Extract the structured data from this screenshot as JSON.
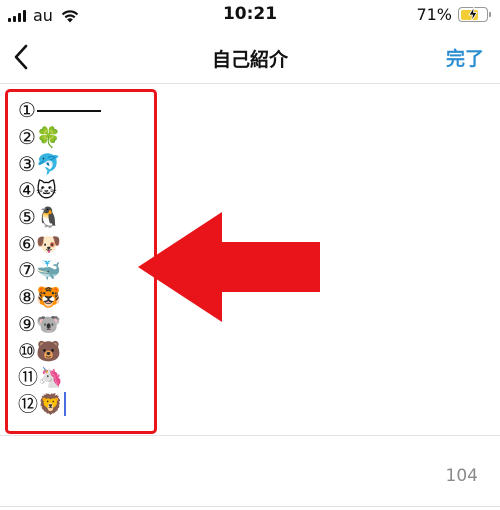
{
  "status_bar": {
    "carrier": "au",
    "time": "10:21",
    "battery_percent": "71%",
    "battery_level": 0.71,
    "battery_color": "#f2cd35"
  },
  "nav": {
    "title": "自己紹介",
    "done_label": "完了",
    "accent_color": "#2b8ed1"
  },
  "bio": {
    "lines": [
      {
        "number": "①",
        "emoji": ""
      },
      {
        "number": "②",
        "emoji": "🍀"
      },
      {
        "number": "③",
        "emoji": "🐬"
      },
      {
        "number": "④",
        "emoji": "🐱"
      },
      {
        "number": "⑤",
        "emoji": "🐧"
      },
      {
        "number": "⑥",
        "emoji": "🐶"
      },
      {
        "number": "⑦",
        "emoji": "🐳"
      },
      {
        "number": "⑧",
        "emoji": "🐯"
      },
      {
        "number": "⑨",
        "emoji": "🐨"
      },
      {
        "number": "⑩",
        "emoji": "🐻"
      },
      {
        "number": "⑪",
        "emoji": "🦄"
      },
      {
        "number": "⑫",
        "emoji": "🦁"
      }
    ]
  },
  "annotation": {
    "color": "#e8141a"
  },
  "footer": {
    "char_count": "104"
  }
}
